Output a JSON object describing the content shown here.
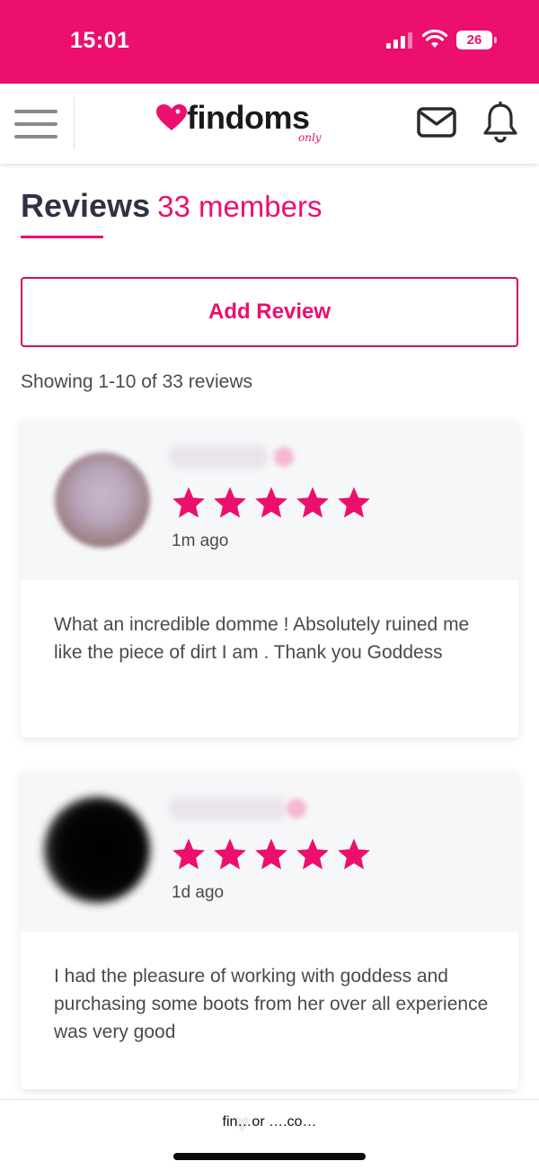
{
  "status_bar": {
    "time": "15:01",
    "battery": "26",
    "icons": [
      "signal-icon",
      "wifi-icon",
      "battery-icon"
    ]
  },
  "header": {
    "logo_text": "findoms",
    "logo_tag": "only",
    "icons": [
      "menu-icon",
      "mail-icon",
      "bell-icon"
    ]
  },
  "colors": {
    "brand": "#ec0f6d",
    "title": "#2f3245",
    "text": "#4a4a4a",
    "card_top": "#f6f7f9"
  },
  "page": {
    "title": "Reviews",
    "member_count": "33 members",
    "add_review_label": "Add Review",
    "showing_text": "Showing 1-10 of 33 reviews"
  },
  "reviews": [
    {
      "time": "1m ago",
      "rating": 5,
      "text": "What an incredible domme ! Absolutely ruined me like the piece of dirt I am . Thank you Goddess"
    },
    {
      "time": "1d ago",
      "rating": 5,
      "text": "I had the pleasure of working with goddess and purchasing some boots from her over all experience was very good"
    }
  ],
  "bottom": {
    "url": "fin…or ….co…"
  }
}
